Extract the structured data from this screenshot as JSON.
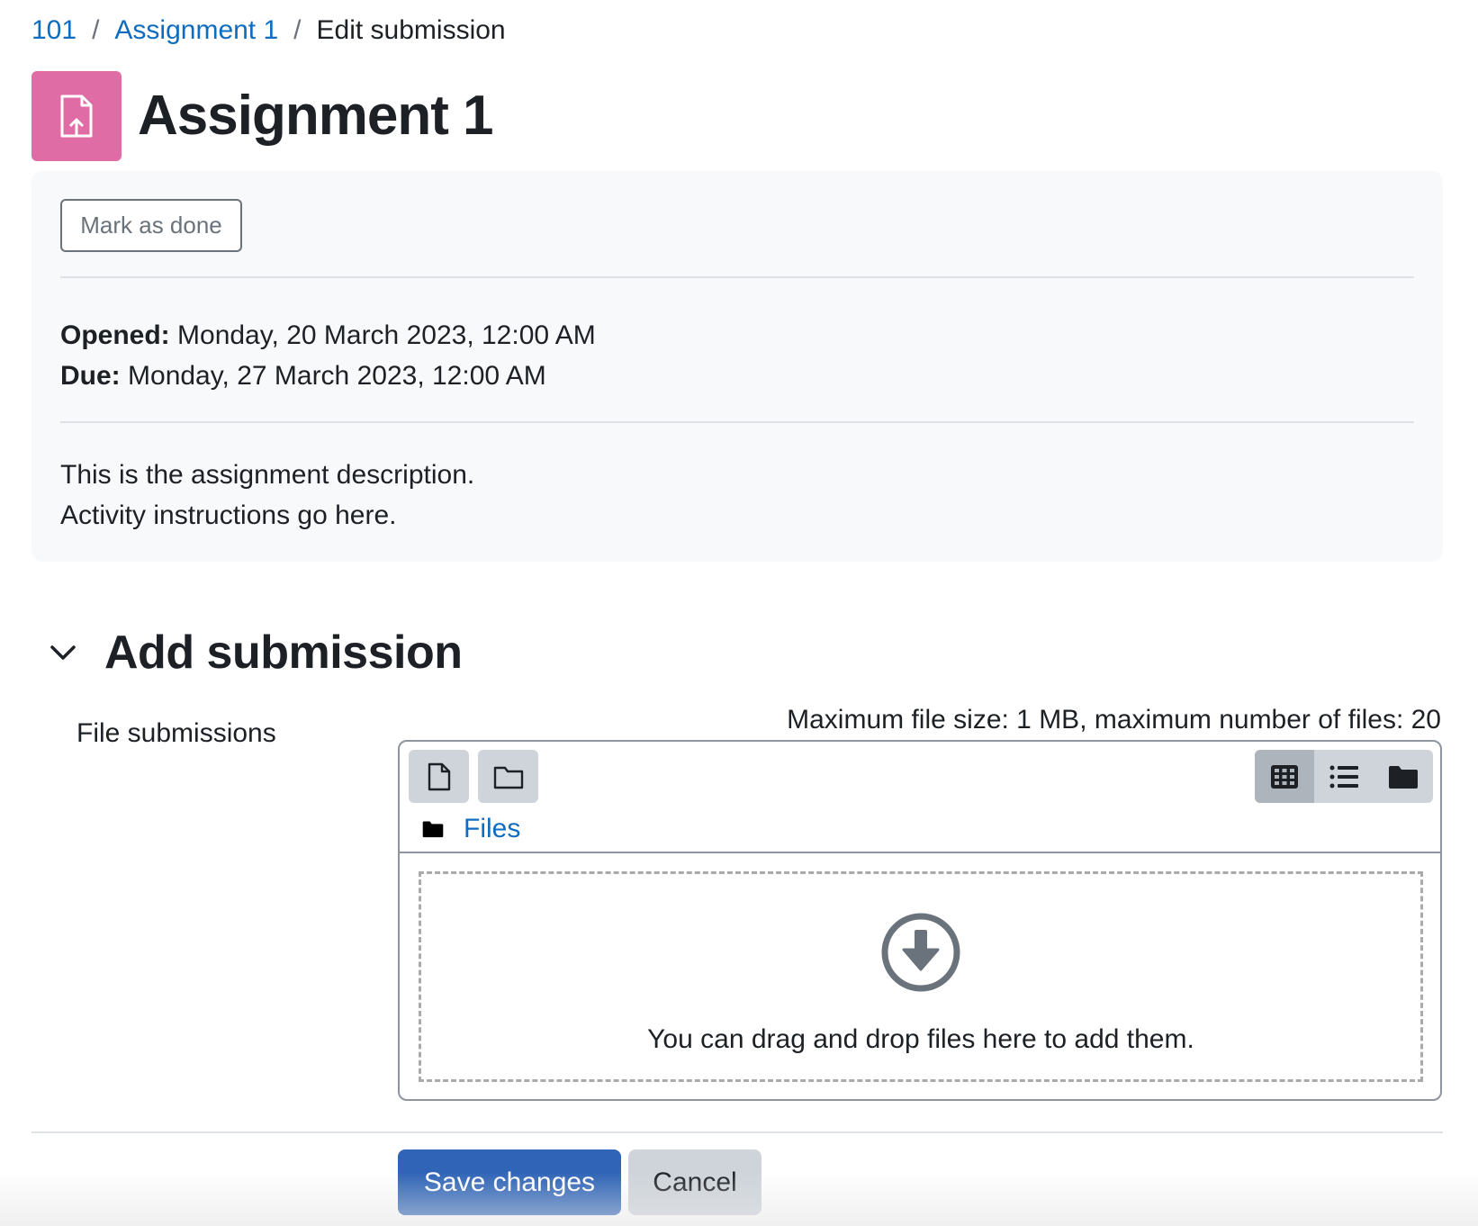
{
  "breadcrumb": {
    "items": [
      {
        "label": "101"
      },
      {
        "label": "Assignment 1"
      },
      {
        "label": "Edit submission"
      }
    ],
    "separator": "/"
  },
  "header": {
    "title": "Assignment 1",
    "icon": "assignment-upload-icon",
    "icon_color": "#e06ca6"
  },
  "info": {
    "mark_done_label": "Mark as done",
    "opened_label": "Opened:",
    "opened_value": "Monday, 20 March 2023, 12:00 AM",
    "due_label": "Due:",
    "due_value": "Monday, 27 March 2023, 12:00 AM",
    "description": [
      "This is the assignment description.",
      "Activity instructions go here."
    ]
  },
  "submission": {
    "section_title": "Add submission",
    "field_label": "File submissions",
    "limits": "Maximum file size: 1 MB, maximum number of files: 20",
    "path_label": "Files",
    "drop_text": "You can drag and drop files here to add them."
  },
  "actions": {
    "save_label": "Save changes",
    "cancel_label": "Cancel",
    "primary_color": "#2f64b7"
  }
}
